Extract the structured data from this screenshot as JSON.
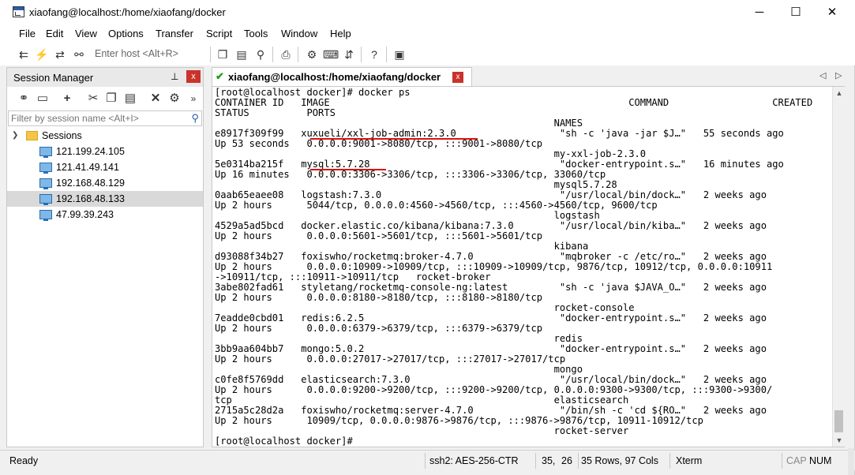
{
  "window": {
    "title": "xiaofang@localhost:/home/xiaofang/docker",
    "minimize": "─",
    "maximize": "☐",
    "close": "✕"
  },
  "menu": [
    "File",
    "Edit",
    "View",
    "Options",
    "Transfer",
    "Script",
    "Tools",
    "Window",
    "Help"
  ],
  "toolbar": {
    "enter_host_placeholder": "Enter host <Alt+R>"
  },
  "session_manager": {
    "title": "Session Manager",
    "pin": "📌",
    "close": "x",
    "filter_placeholder": "Filter by session name <Alt+I>",
    "root": "Sessions",
    "sessions": [
      "121.199.24.105",
      "121.41.49.141",
      "192.168.48.129",
      "192.168.48.133",
      "47.99.39.243"
    ],
    "selected_index": 3
  },
  "tab": {
    "label": "xiaofang@localhost:/home/xiaofang/docker",
    "close": "x"
  },
  "terminal": {
    "lines": [
      "[root@localhost docker]# docker ps",
      "CONTAINER ID   IMAGE                                                    COMMAND                  CREATED",
      "STATUS          PORTS",
      "                                                           NAMES",
      "e8917f309f99   xuxueli/xxl-job-admin:2.3.0                  \"sh -c 'java -jar $J…\"   55 seconds ago",
      "Up 53 seconds   0.0.0.0:9001->8080/tcp, :::9001->8080/tcp",
      "                                                           my-xxl-job-2.3.0",
      "5e0314ba215f   mysql:5.7.28                                 \"docker-entrypoint.s…\"   16 minutes ago",
      "Up 16 minutes   0.0.0.0:3306->3306/tcp, :::3306->3306/tcp, 33060/tcp",
      "                                                           mysql5.7.28",
      "0aab65eaee08   logstash:7.3.0                               \"/usr/local/bin/dock…\"   2 weeks ago",
      "Up 2 hours      5044/tcp, 0.0.0.0:4560->4560/tcp, :::4560->4560/tcp, 9600/tcp",
      "                                                           logstash",
      "4529a5ad5bcd   docker.elastic.co/kibana/kibana:7.3.0        \"/usr/local/bin/kiba…\"   2 weeks ago",
      "Up 2 hours      0.0.0.0:5601->5601/tcp, :::5601->5601/tcp",
      "                                                           kibana",
      "d93088f34b27   foxiswho/rocketmq:broker-4.7.0               \"mqbroker -c /etc/ro…\"   2 weeks ago",
      "Up 2 hours      0.0.0.0:10909->10909/tcp, :::10909->10909/tcp, 9876/tcp, 10912/tcp, 0.0.0.0:10911",
      "->10911/tcp, :::10911->10911/tcp   rocket-broker",
      "3abe802fad61   styletang/rocketmq-console-ng:latest         \"sh -c 'java $JAVA_O…\"   2 weeks ago",
      "Up 2 hours      0.0.0.0:8180->8180/tcp, :::8180->8180/tcp",
      "                                                           rocket-console",
      "7eadde0cbd01   redis:6.2.5                                  \"docker-entrypoint.s…\"   2 weeks ago",
      "Up 2 hours      0.0.0.0:6379->6379/tcp, :::6379->6379/tcp",
      "                                                           redis",
      "3bb9aa604bb7   mongo:5.0.2                                  \"docker-entrypoint.s…\"   2 weeks ago",
      "Up 2 hours      0.0.0.0:27017->27017/tcp, :::27017->27017/tcp",
      "                                                           mongo",
      "c0fe8f5769dd   elasticsearch:7.3.0                          \"/usr/local/bin/dock…\"   2 weeks ago",
      "Up 2 hours      0.0.0.0:9200->9200/tcp, :::9200->9200/tcp, 0.0.0.0:9300->9300/tcp, :::9300->9300/",
      "tcp                                                        elasticsearch",
      "2715a5c28d2a   foxiswho/rocketmq:server-4.7.0               \"/bin/sh -c 'cd ${RO…\"   2 weeks ago",
      "Up 2 hours      10909/tcp, 0.0.0.0:9876->9876/tcp, :::9876->9876/tcp, 10911-10912/tcp",
      "                                                           rocket-server",
      "[root@localhost docker]#"
    ]
  },
  "status": {
    "ready": "Ready",
    "protocol": "ssh2: AES-256-CTR",
    "row": "35,",
    "col": "26",
    "size": "35 Rows, 97 Cols",
    "term": "Xterm",
    "cap": "CAP",
    "num": "NUM"
  }
}
